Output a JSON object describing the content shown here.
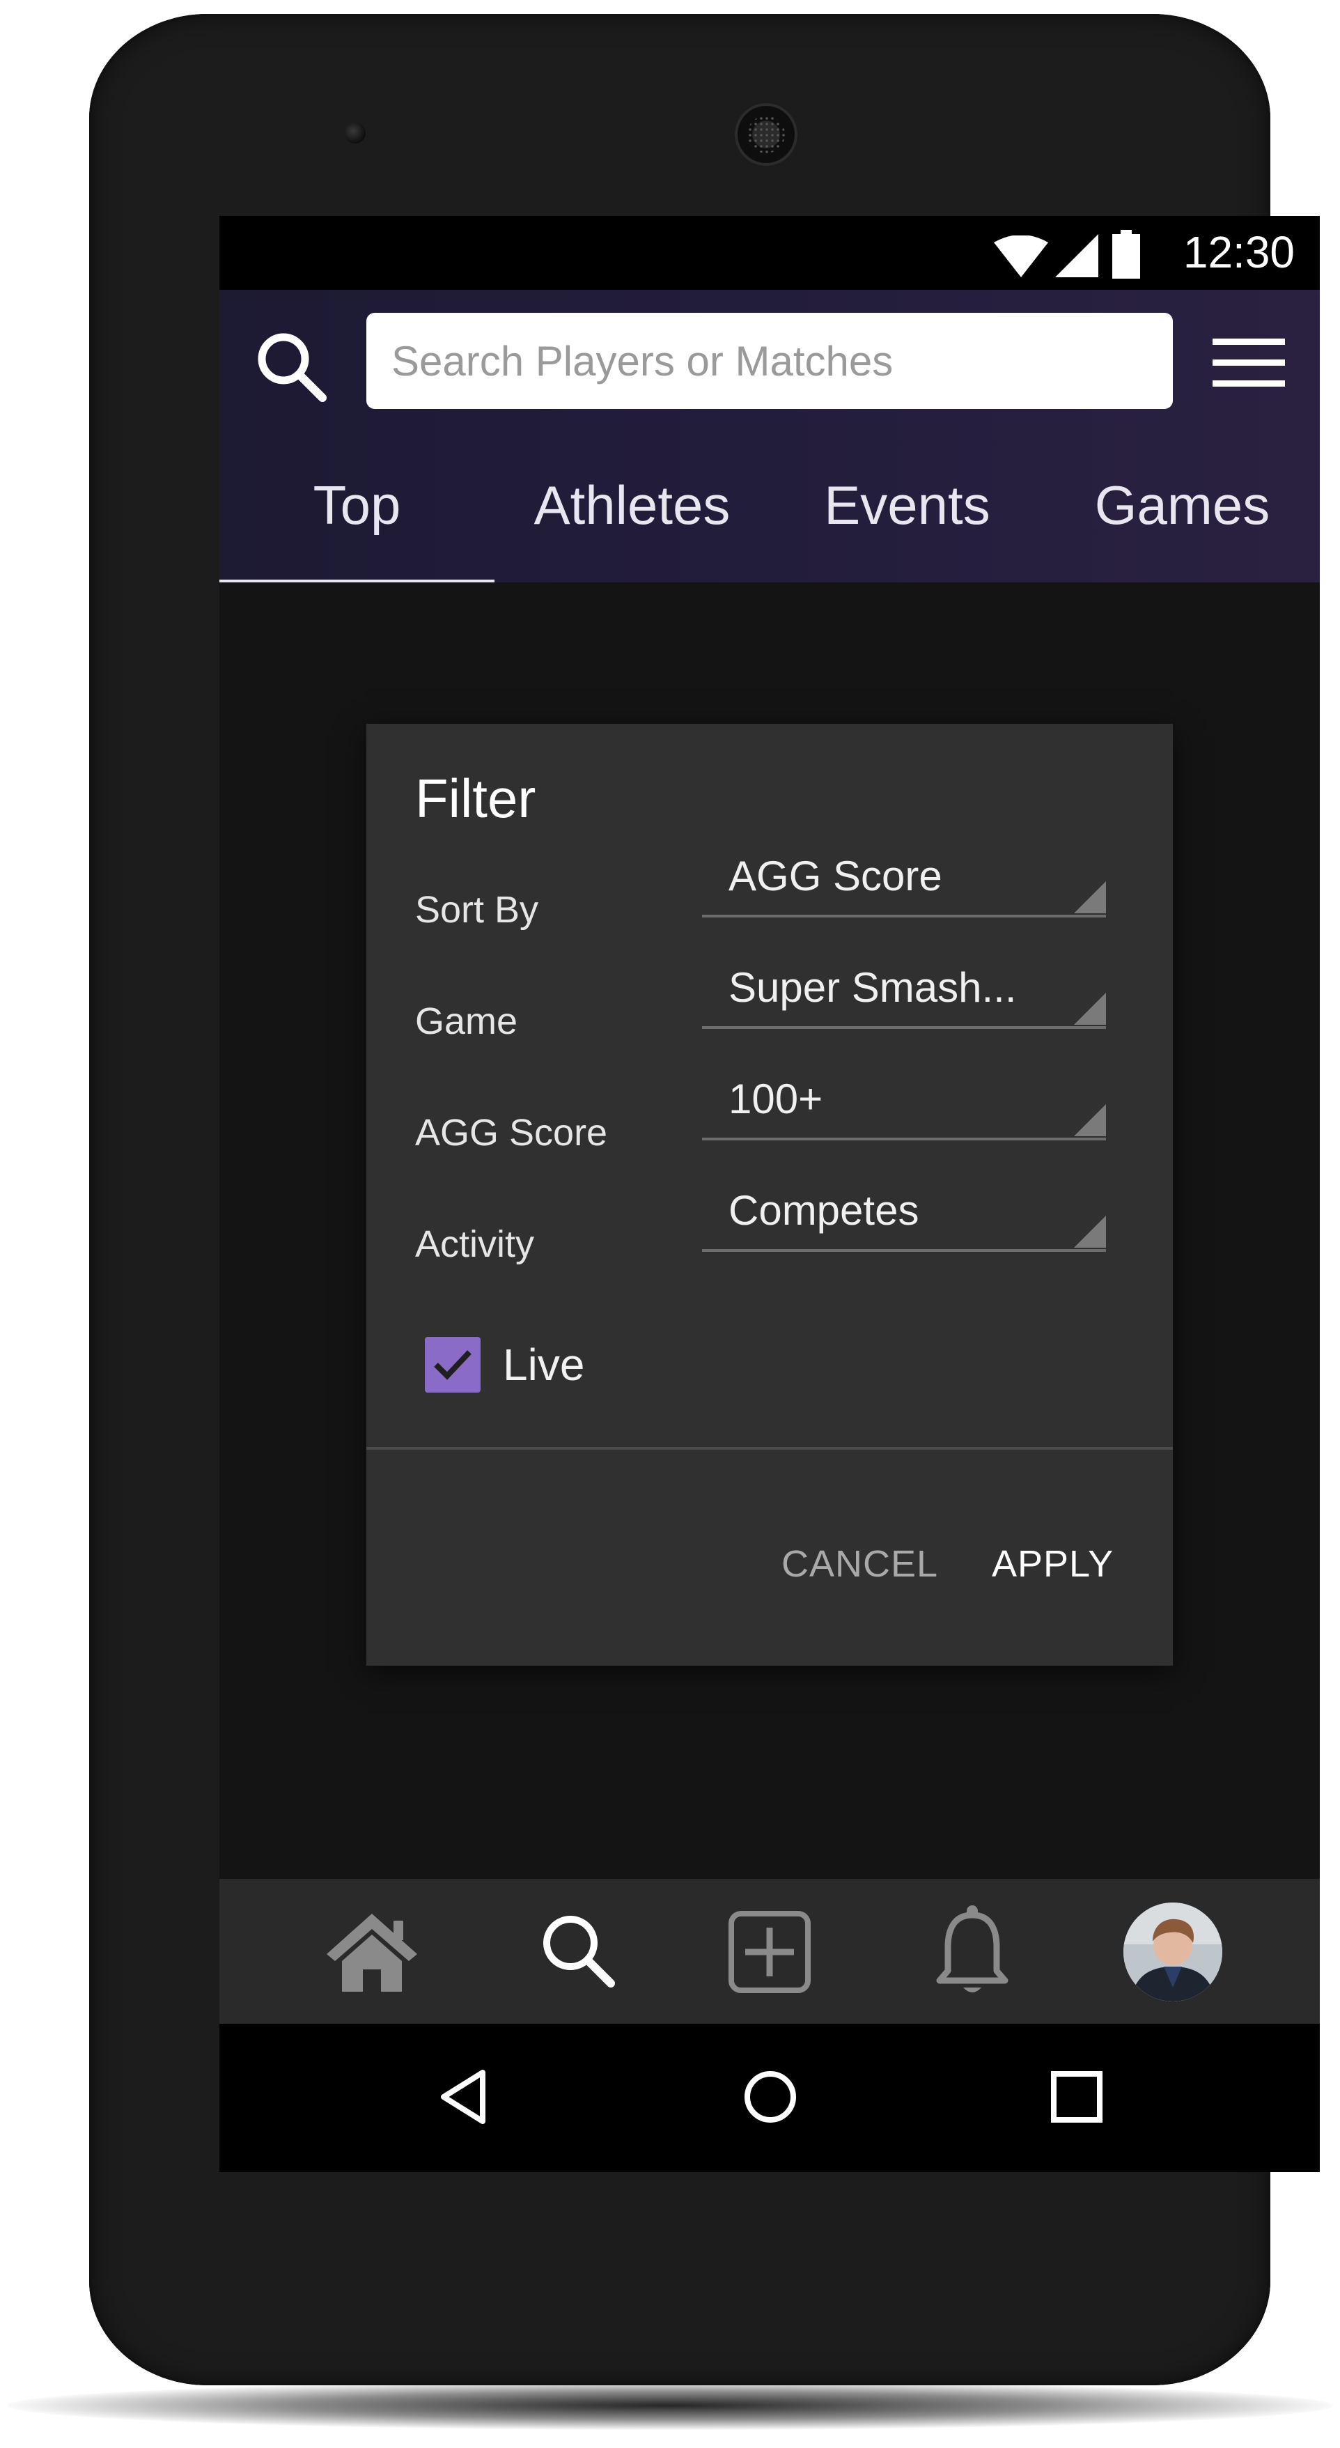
{
  "status_bar": {
    "time": "12:30"
  },
  "search": {
    "placeholder": "Search Players or Matches"
  },
  "tabs": [
    {
      "label": "Top",
      "active": true
    },
    {
      "label": "Athletes",
      "active": false
    },
    {
      "label": "Events",
      "active": false
    },
    {
      "label": "Games",
      "active": false
    }
  ],
  "filter_dialog": {
    "title": "Filter",
    "rows": [
      {
        "label": "Sort By",
        "value": "AGG Score"
      },
      {
        "label": "Game",
        "value": "Super Smash..."
      },
      {
        "label": "AGG Score",
        "value": "100+"
      },
      {
        "label": "Activity",
        "value": "Competes"
      }
    ],
    "live_checkbox": {
      "label": "Live",
      "checked": true
    },
    "cancel_label": "CANCEL",
    "apply_label": "APPLY"
  },
  "bottom_nav": [
    "home-icon",
    "search-icon",
    "add-icon",
    "bell-icon",
    "avatar"
  ],
  "colors": {
    "header_bg": "#231d3c",
    "accent": "#8a6bc7",
    "dialog_bg": "#303030",
    "screen_bg": "#141414"
  }
}
